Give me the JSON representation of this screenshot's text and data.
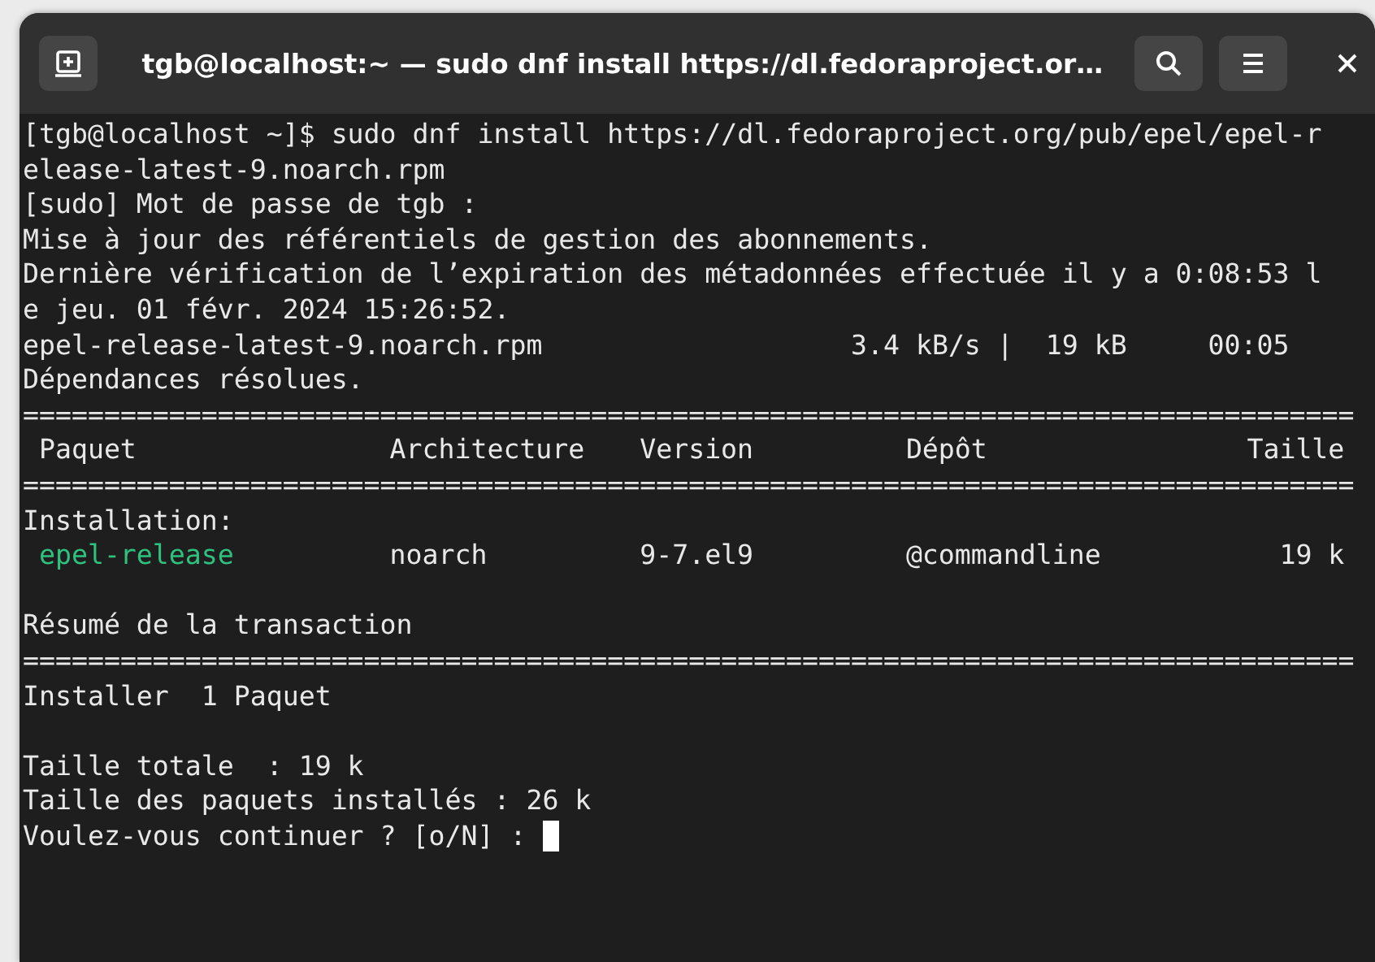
{
  "window": {
    "title": "tgb@localhost:~ — sudo dnf install https://dl.fedoraproject.or…"
  },
  "terminal": {
    "lines": [
      {
        "kind": "text",
        "text": "[tgb@localhost ~]$ sudo dnf install https://dl.fedoraproject.org/pub/epel/epel-r"
      },
      {
        "kind": "text",
        "text": "elease-latest-9.noarch.rpm"
      },
      {
        "kind": "text",
        "text": "[sudo] Mot de passe de tgb :"
      },
      {
        "kind": "text",
        "text": "Mise à jour des référentiels de gestion des abonnements."
      },
      {
        "kind": "text",
        "text": "Dernière vérification de l’expiration des métadonnées effectuée il y a 0:08:53 l"
      },
      {
        "kind": "text",
        "text": "e jeu. 01 févr. 2024 15:26:52."
      },
      {
        "kind": "text",
        "text": "epel-release-latest-9.noarch.rpm                   3.4 kB/s |  19 kB     00:05"
      },
      {
        "kind": "text",
        "text": "Dépendances résolues."
      },
      {
        "kind": "text",
        "text": "=================================================================================="
      },
      {
        "kind": "columns",
        "cells": [
          "Paquet",
          "Architecture",
          "Version",
          "Dépôt",
          "Taille"
        ]
      },
      {
        "kind": "text",
        "text": "=================================================================================="
      },
      {
        "kind": "text",
        "text": "Installation:"
      },
      {
        "kind": "package",
        "cells": [
          "epel-release",
          "noarch",
          "9-7.el9",
          "@commandline",
          "19 k"
        ]
      },
      {
        "kind": "blank"
      },
      {
        "kind": "text",
        "text": "Résumé de la transaction"
      },
      {
        "kind": "text",
        "text": "=================================================================================="
      },
      {
        "kind": "text",
        "text": "Installer  1 Paquet"
      },
      {
        "kind": "blank"
      },
      {
        "kind": "text",
        "text": "Taille totale  : 19 k"
      },
      {
        "kind": "text",
        "text": "Taille des paquets installés : 26 k"
      },
      {
        "kind": "text",
        "text": "Voulez-vous continuer ? [o/N] : ",
        "cursor": true
      }
    ]
  }
}
